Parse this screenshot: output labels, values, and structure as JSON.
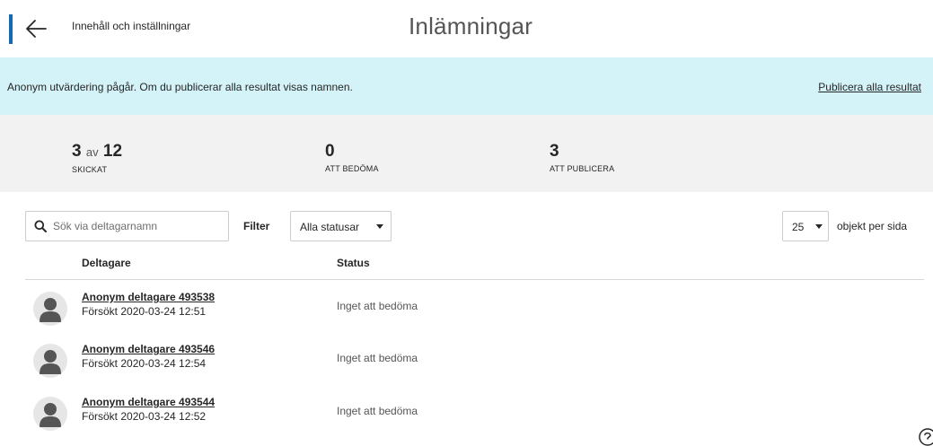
{
  "header": {
    "back_label": "Innehåll och inställningar",
    "title": "Inlämningar",
    "accent_color": "#1869b5"
  },
  "banner": {
    "message": "Anonym utvärdering pågår. Om du publicerar alla resultat visas namnen.",
    "action_label": "Publicera alla resultat",
    "background_color": "#d4f3f9"
  },
  "stats": {
    "submitted": {
      "value": "3",
      "of_word": "av",
      "total": "12",
      "label": "SKICKAT"
    },
    "to_grade": {
      "value": "0",
      "label": "ATT BEDÖMA"
    },
    "to_publish": {
      "value": "3",
      "label": "ATT PUBLICERA"
    }
  },
  "toolbar": {
    "search_placeholder": "Sök via deltagarnamn",
    "filter_label": "Filter",
    "status_filter_value": "Alla statusar",
    "per_page_value": "25",
    "per_page_label": "objekt per sida"
  },
  "table": {
    "columns": [
      "Deltagare",
      "Status"
    ],
    "rows": [
      {
        "name": "Anonym deltagare 493538",
        "attempt": "Försökt 2020-03-24 12:51",
        "status": "Inget att bedöma"
      },
      {
        "name": "Anonym deltagare 493546",
        "attempt": "Försökt 2020-03-24 12:54",
        "status": "Inget att bedöma"
      },
      {
        "name": "Anonym deltagare 493544",
        "attempt": "Försökt 2020-03-24 12:52",
        "status": "Inget att bedöma"
      }
    ]
  },
  "icons": {
    "back": "arrow-left-icon",
    "search": "search-icon",
    "caret": "caret-down-icon",
    "avatar": "user-silhouette-icon",
    "help": "help-icon"
  }
}
